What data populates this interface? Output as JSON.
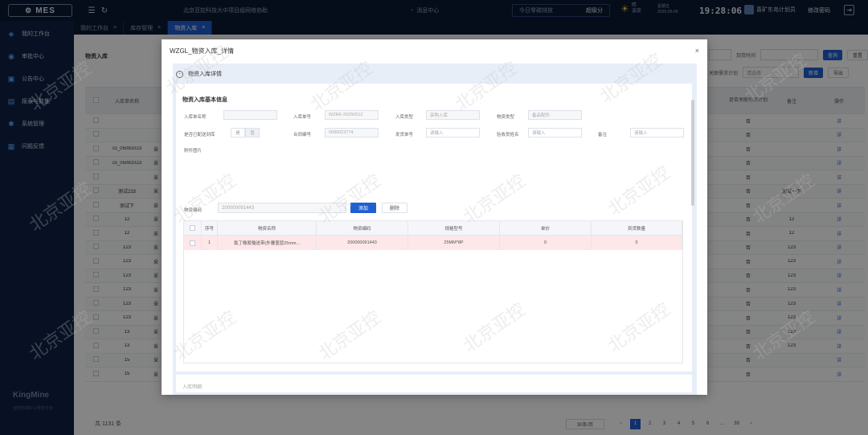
{
  "topbar": {
    "logo": "MES",
    "title": "北京亚控科技大中项目组网络协助",
    "message_center": "消息中心",
    "today_label": "今日零碳排放",
    "today_value": "超级分",
    "weather": "晴",
    "weather_sub": "温度",
    "date_line1": "星期五",
    "date_line2": "2025-05-09",
    "time": "19:28:06",
    "user": "喜矿东岛计划员",
    "change_password": "修改密码"
  },
  "sidebar": {
    "items": [
      {
        "label": "我的工作台",
        "icon": "layers-icon"
      },
      {
        "label": "审批中心",
        "icon": "globe-icon"
      },
      {
        "label": "公告中心",
        "icon": "monitor-icon"
      },
      {
        "label": "报表与数据",
        "icon": "chart-icon"
      },
      {
        "label": "系统管理",
        "icon": "settings-icon"
      },
      {
        "label": "问题反馈",
        "icon": "feedback-icon"
      }
    ],
    "brand": "KingMine",
    "brand_sub": "亚控科技矿山管控平台"
  },
  "tabs": [
    {
      "label": "我的工作台",
      "active": false
    },
    {
      "label": "库存管理",
      "active": false
    },
    {
      "label": "物资入库",
      "active": true
    }
  ],
  "main": {
    "title": "物资入库",
    "date_label": "到货时间",
    "search_label": "查询",
    "reset_label": "重置",
    "related_label": "关联需求计划",
    "related_placeholder": "请选择",
    "add_label": "新增",
    "export_label": "导出",
    "table": {
      "headers": [
        "",
        "入库单名称",
        "",
        "是否关联需求计划",
        "备注",
        "操作"
      ],
      "rows": [
        [
          "",
          "",
          "",
          "否",
          "",
          "详"
        ],
        [
          "",
          "",
          "",
          "否",
          "",
          "详"
        ],
        [
          "",
          "cs_05081023",
          "采",
          "否",
          "",
          "详"
        ],
        [
          "",
          "cs_05081023",
          "采",
          "否",
          "",
          "详"
        ],
        [
          "",
          "",
          "采",
          "否",
          "",
          "详"
        ],
        [
          "",
          "测试233",
          "采",
          "否",
          "测试一下",
          "详"
        ],
        [
          "",
          "测试下",
          "采",
          "否",
          "",
          "详"
        ],
        [
          "",
          "12",
          "采",
          "否",
          "12",
          "详"
        ],
        [
          "",
          "12",
          "采",
          "否",
          "12",
          "详"
        ],
        [
          "",
          "123",
          "采",
          "否",
          "123",
          "详"
        ],
        [
          "",
          "123",
          "采",
          "否",
          "123",
          "详"
        ],
        [
          "",
          "123",
          "采",
          "否",
          "123",
          "详"
        ],
        [
          "",
          "123",
          "采",
          "否",
          "123",
          "详"
        ],
        [
          "",
          "123",
          "采",
          "否",
          "123",
          "详"
        ],
        [
          "",
          "123",
          "采",
          "否",
          "123",
          "详"
        ],
        [
          "",
          "13",
          "采",
          "否",
          "123",
          "详"
        ],
        [
          "",
          "13",
          "采",
          "否",
          "123",
          "详"
        ],
        [
          "",
          "15",
          "采",
          "否",
          "",
          "详"
        ],
        [
          "",
          "15",
          "采",
          "否",
          "",
          "详"
        ]
      ]
    },
    "pager": {
      "total": "共 1131 条",
      "page_size": "30条/页",
      "pages": [
        "1",
        "2",
        "3",
        "4",
        "5",
        "6",
        "...",
        "38"
      ],
      "current": "1"
    }
  },
  "modal": {
    "title": "WZGL_物资入库_详情",
    "section_title": "物资入库详情",
    "panel_title": "物资入库基本信息",
    "fields": {
      "name_label": "入库单名称",
      "name_value": "",
      "no_label": "入库单号",
      "no_value": "WZRK-20250512",
      "type_label": "入库类型",
      "type_value": "采购入库",
      "stock_type_label": "物资类型",
      "stock_type_value": "备品配件",
      "relate_label": "是否已配送到库",
      "relate_yes": "是",
      "relate_no": "否",
      "contract_label": "合同编号",
      "contract_value": "0080023774",
      "receipt_label": "发货单号",
      "receipt_placeholder": "请输入",
      "handler_label": "验收员姓名",
      "handler_placeholder": "请输入",
      "remark_label": "备注",
      "remark_placeholder": "请输入",
      "attach_label": "附件图片"
    },
    "code_label": "物资编码",
    "code_value": "200000091443",
    "add_label": "添加",
    "delete_label": "删除",
    "items_table": {
      "headers": [
        "",
        "序号",
        "物资名称",
        "物资编码",
        "规格型号",
        "单价",
        "到货数量"
      ],
      "rows": [
        [
          "",
          "1",
          "氯丁橡胶输送带(外覆盖层25mm...",
          "200000091443",
          "25MM*8P",
          "0",
          "0"
        ]
      ]
    },
    "next_section": "入库明细"
  },
  "watermark": "北京亚控"
}
